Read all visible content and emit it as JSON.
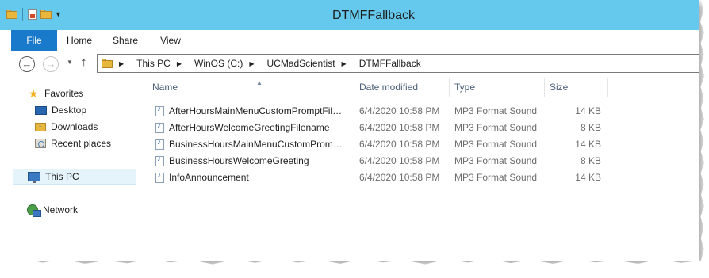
{
  "window": {
    "title": "DTMFFallback",
    "accent_color": "#64c9ec",
    "file_tab_color": "#1979ca"
  },
  "ribbon": {
    "tabs": [
      "File",
      "Home",
      "Share",
      "View"
    ]
  },
  "address_bar": {
    "crumbs": [
      "This PC",
      "WinOS (C:)",
      "UCMadScientist",
      "DTMFFallback"
    ]
  },
  "nav_pane": {
    "favorites": "Favorites",
    "desktop": "Desktop",
    "downloads": "Downloads",
    "recent_places": "Recent places",
    "this_pc": "This PC",
    "network": "Network"
  },
  "columns": {
    "name": "Name",
    "date": "Date modified",
    "type": "Type",
    "size": "Size"
  },
  "files": [
    {
      "name": "AfterHoursMainMenuCustomPromptFile...",
      "date": "6/4/2020 10:58 PM",
      "type": "MP3 Format Sound",
      "size": "14 KB"
    },
    {
      "name": "AfterHoursWelcomeGreetingFilename",
      "date": "6/4/2020 10:58 PM",
      "type": "MP3 Format Sound",
      "size": "8 KB"
    },
    {
      "name": "BusinessHoursMainMenuCustomPrompt...",
      "date": "6/4/2020 10:58 PM",
      "type": "MP3 Format Sound",
      "size": "14 KB"
    },
    {
      "name": "BusinessHoursWelcomeGreeting",
      "date": "6/4/2020 10:58 PM",
      "type": "MP3 Format Sound",
      "size": "8 KB"
    },
    {
      "name": "InfoAnnouncement",
      "date": "6/4/2020 10:58 PM",
      "type": "MP3 Format Sound",
      "size": "14 KB"
    }
  ]
}
